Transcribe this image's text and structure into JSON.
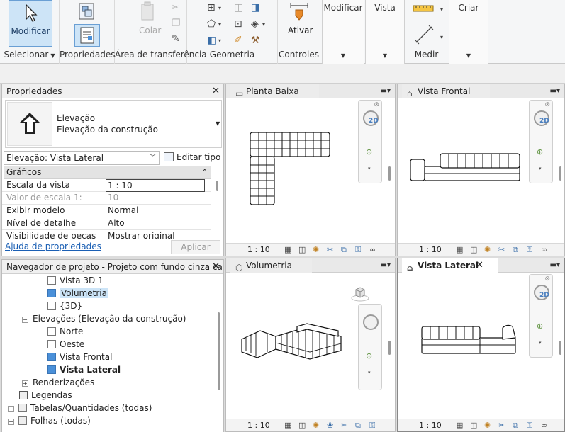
{
  "ribbon": {
    "modify_label": "Modificar",
    "groups": {
      "selecionar": "Selecionar",
      "propriedades": "Propriedades",
      "transferencia": "Área de transferência",
      "geometria": "Geometria",
      "controles": "Controles",
      "medir": "Medir"
    },
    "colar": "Colar",
    "ativar": "Ativar",
    "tabs": [
      "Modificar",
      "Vista",
      "Criar"
    ]
  },
  "properties": {
    "title": "Propriedades",
    "type_line1": "Elevação",
    "type_line2": "Elevação da construção",
    "selector": "Elevação: Vista Lateral",
    "edit_type": "Editar tipo",
    "section": "Gráficos",
    "rows": [
      {
        "label": "Escala da vista",
        "value": "1 : 10"
      },
      {
        "label": "Valor de escala    1:",
        "value": "10"
      },
      {
        "label": "Exibir modelo",
        "value": "Normal"
      },
      {
        "label": "Nível de detalhe",
        "value": "Alto"
      },
      {
        "label": "Visibilidade de peças",
        "value": "Mostrar original"
      }
    ],
    "help_link": "Ajuda de propriedades",
    "apply": "Aplicar"
  },
  "browser": {
    "title": "Navegador de projeto - Projeto com fundo cinza car...",
    "items": [
      {
        "label": "Vista 3D 1"
      },
      {
        "label": "Volumetria"
      },
      {
        "label": "{3D}"
      },
      {
        "label": "Elevações (Elevação da construção)"
      },
      {
        "label": "Norte"
      },
      {
        "label": "Oeste"
      },
      {
        "label": "Vista Frontal"
      },
      {
        "label": "Vista Lateral"
      },
      {
        "label": "Renderizações"
      },
      {
        "label": "Legendas"
      },
      {
        "label": "Tabelas/Quantidades (todas)"
      },
      {
        "label": "Folhas (todas)"
      }
    ]
  },
  "viewports": [
    {
      "title": "Planta Baixa",
      "scale": "1 : 10"
    },
    {
      "title": "Vista Frontal",
      "scale": "1 : 10"
    },
    {
      "title": "Volumetria",
      "scale": "1 : 10"
    },
    {
      "title": "Vista Lateral",
      "scale": "1 : 10"
    }
  ],
  "nav_2d": "2D",
  "icons": {
    "close": "close-icon",
    "menu": "dropdown-icon",
    "elevation": "elevation-arrow-icon",
    "checkbox": "checkbox-icon",
    "expand": "expand-icon",
    "view_cube": "view-cube-icon",
    "steering_wheel": "steering-wheel-icon",
    "zoom": "zoom-icon"
  },
  "colors": {
    "accent": "#4a90d9",
    "ribbon_bg": "#f5f6f7",
    "panel_bg": "#ffffff"
  }
}
